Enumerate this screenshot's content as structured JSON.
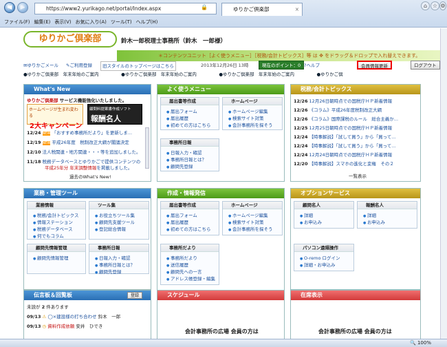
{
  "browser": {
    "url": "https://www2.yurikago.net/portal/Index.aspx",
    "tab_title": "ゆりかご倶楽部",
    "menu": [
      "ファイル(F)",
      "編集(E)",
      "表示(V)",
      "お気に入り(A)",
      "ツール(T)",
      "ヘルプ(H)"
    ],
    "status_zoom": "100%"
  },
  "header": {
    "logo_text": "ゆりかご倶楽部",
    "office_name": "鈴木一郎税理士事務所（鈴木　一郎様）",
    "banner_text": "＊コンテンツユニット［よく使うメニュー］［税務/会計トピックス］等 は ✥ をドラッグ＆ドロップで入れ替えできます。",
    "toolbar": {
      "mail": "ゆりかごメール",
      "register": "ご利用登録",
      "old_style": "旧スタイルのトップページはこちら",
      "date": "2013年12月26日 13時",
      "points_label": "現在のポイント：",
      "points_value": "0",
      "help": "ヘルプ",
      "member_update": "会員情報更新",
      "logout": "ログアウト"
    },
    "subnav": "●ゆりかご倶楽部　年末年始のご案内　　　　　●ゆりかご倶楽部　年末年始のご案内　　　　　●ゆりかご倶楽部　年末年始のご案内　　　　　●ゆりかご倶"
  },
  "whats_new": {
    "title": "What's New",
    "headline_prefix": "ゆりかご倶楽部",
    "headline": "サービス機能強化いたしました。",
    "ad1_line1": "ホームページが生まれ変わる",
    "ad1_line2": "2大キャンペーン",
    "ad2_line1": "顧問料提案書作成ソフト",
    "ad2_line2": "報酬名人",
    "items": [
      {
        "date": "12/24",
        "text": "「おすすめ事務所だより」を更新しま..."
      },
      {
        "date": "12/19",
        "text": "平成26年度　税制改正大綱が閣議決定"
      },
      {
        "date": "12/10",
        "text": "法人税関連・地方関連・・・等を追加しました。"
      },
      {
        "date": "11/18",
        "text": "税務データベースとゆりかごで提供コンテンツの"
      }
    ],
    "item_highlight": "平成25年分 年末調整情報",
    "item_highlight_suffix": "を掲載しました。",
    "more": "過去のWhat's New!"
  },
  "yoku_menu": {
    "title": "よく使うメニュー",
    "boxes": [
      {
        "title": "届出書等作成",
        "items": [
          "届出フォーム",
          "届出履歴",
          "初めての方はこちら"
        ]
      },
      {
        "title": "ホームページ",
        "items": [
          "ホームページ編集",
          "検索サイト対策",
          "会計事務所を探そう"
        ]
      },
      {
        "title": "事務所日報",
        "items": [
          "日報入力・確認",
          "事務所日報とは？",
          "顧問先登録"
        ]
      }
    ]
  },
  "topics": {
    "title": "税務/会計トピックス",
    "items": [
      {
        "date": "12/26",
        "text": "12月26日朝時点での国税庁ＨＰ新着情報"
      },
      {
        "date": "12/26",
        "text": "《コラム》平成26年度税制改正大綱"
      },
      {
        "date": "12/26",
        "text": "《コラム》国際課税のルール　総合主義か..."
      },
      {
        "date": "12/25",
        "text": "12月25日朝時点での国税庁ＨＰ新着情報"
      },
      {
        "date": "12/24",
        "text": "【時事解説】「試して買う」から「買って..."
      },
      {
        "date": "12/24",
        "text": "【時事解説】「試して買う」から「買って..."
      },
      {
        "date": "12/24",
        "text": "12月24日朝時点での国税庁ＨＰ新着情報"
      },
      {
        "date": "12/20",
        "text": "【時事解説】スマホの進化と変権　その２"
      }
    ],
    "more": "一覧表示"
  },
  "gyomu": {
    "title": "業務・管理ツール",
    "boxes": [
      {
        "title": "業務情報",
        "items": [
          "税務/会計トピックス",
          "情報ステーション",
          "税務データベース",
          "何でもコラム"
        ]
      },
      {
        "title": "ツール集",
        "items": [
          "お役立ちツール集",
          "顧問先支援ツール",
          "登記総合情報"
        ]
      },
      {
        "title": "顧問先情報管理",
        "items": [
          "顧問先情報管理"
        ]
      },
      {
        "title": "事務所日報",
        "items": [
          "日報入力・確認",
          "事務所日報とは？",
          "顧問先登録"
        ]
      }
    ]
  },
  "sakusei": {
    "title": "作成・情報発信",
    "boxes": [
      {
        "title": "届出書等作成",
        "items": [
          "届出フォーム",
          "届出履歴",
          "初めての方はこちら"
        ]
      },
      {
        "title": "ホームページ",
        "items": [
          "ホームページ編集",
          "検索サイト対策",
          "会計事務所を探そう"
        ]
      },
      {
        "title": "事務所だより",
        "items": [
          "事務所だより",
          "送信履歴",
          "顧問先への一言",
          "アドレス帳登録・編集"
        ]
      }
    ]
  },
  "options": {
    "title": "オプションサービス",
    "boxes": [
      {
        "title": "顧問名人",
        "items": [
          "詳細",
          "お申込み"
        ]
      },
      {
        "title": "報酬名人",
        "items": [
          "詳細",
          "お申込み"
        ]
      },
      {
        "title": "パソコン遠隔操作",
        "items": [
          "O-remo ログイン",
          "詳細・お申込み"
        ]
      }
    ]
  },
  "bulletin": {
    "title": "伝言板＆回覧板",
    "register": "登録",
    "unread_prefix": "未読が",
    "unread_count": "2",
    "unread_suffix": "件あります",
    "items": [
      {
        "date": "09/13",
        "text": "◯×建設様の打ち合わせ",
        "who": "鈴木　一郎"
      },
      {
        "date": "09/13",
        "text": "資料作成依頼",
        "who": "安井　ひでき"
      }
    ]
  },
  "schedule": {
    "title": "スケジュール",
    "footer": "会計事務所の広場 会員の方は"
  },
  "zaiseki": {
    "title": "在席表示",
    "footer": "会計事務所の広場 会員の方は"
  }
}
